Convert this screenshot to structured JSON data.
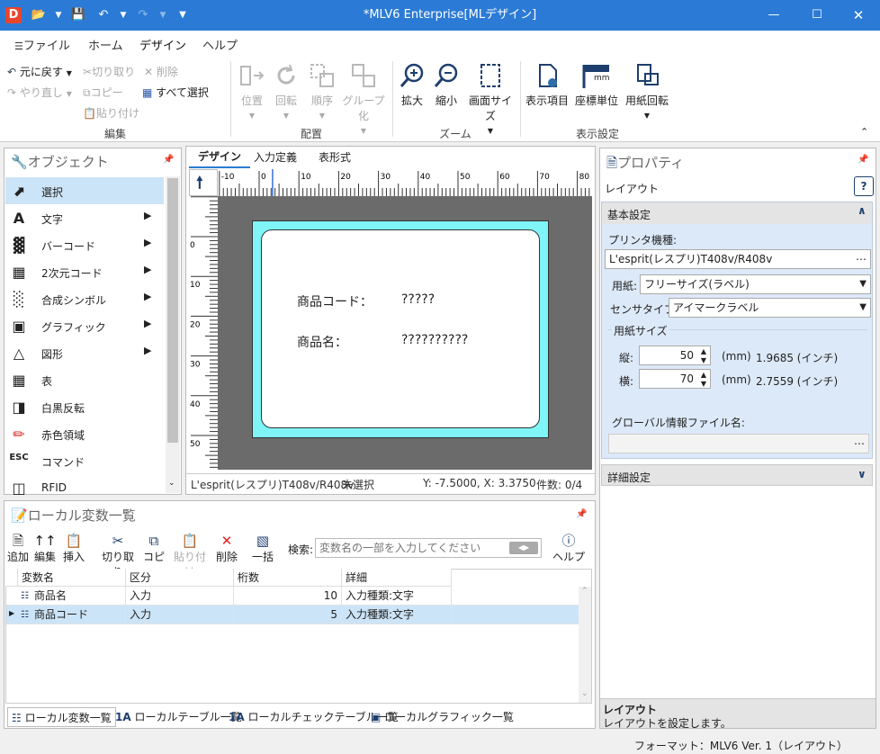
{
  "window": {
    "title": "*MLV6 Enterprise[MLデザイン]"
  },
  "ribbon": {
    "tabs": [
      "ファイル",
      "ホーム",
      "デザイン",
      "ヘルプ"
    ],
    "edit": {
      "undo": "元に戻す",
      "redo": "やり直し",
      "cut": "切り取り",
      "copy": "コピー",
      "paste": "貼り付け",
      "delete": "削除",
      "select_all": "すべて選択",
      "group": "編集"
    },
    "arrange": {
      "position": "位置",
      "rotate": "回転",
      "order": "順序",
      "group_btn": "グループ化",
      "group": "配置"
    },
    "zoom": {
      "zoom_in": "拡大",
      "zoom_out": "縮小",
      "screen_size": "画面サイズ",
      "group": "ズーム"
    },
    "display": {
      "display_items": "表示項目",
      "coord_unit": "座標単位",
      "paper_rotate": "用紙回転",
      "group": "表示設定",
      "mm": "mm"
    }
  },
  "objects": {
    "title": "オブジェクト",
    "items": [
      {
        "label": "選択",
        "icon": "cursor-icon"
      },
      {
        "label": "文字",
        "icon": "text-icon"
      },
      {
        "label": "バーコード",
        "icon": "barcode-icon"
      },
      {
        "label": "2次元コード",
        "icon": "qrcode-icon"
      },
      {
        "label": "合成シンボル",
        "icon": "composite-symbol-icon"
      },
      {
        "label": "グラフィック",
        "icon": "graphic-icon"
      },
      {
        "label": "図形",
        "icon": "shape-icon"
      },
      {
        "label": "表",
        "icon": "table-icon"
      },
      {
        "label": "白黒反転",
        "icon": "invert-icon"
      },
      {
        "label": "赤色領域",
        "icon": "red-area-icon"
      },
      {
        "label": "コマンド",
        "icon": "esc-command-icon"
      },
      {
        "label": "RFID",
        "icon": "rfid-icon"
      }
    ]
  },
  "design": {
    "tabs": [
      "デザイン",
      "入力定義",
      "表形式"
    ],
    "ruler_h": [
      "-10",
      "0",
      "10",
      "20",
      "30",
      "40",
      "50",
      "60",
      "70",
      "80"
    ],
    "ruler_v": [
      "0",
      "10",
      "20",
      "30",
      "40",
      "50"
    ],
    "label": {
      "row1_key": "商品コード：",
      "row1_val": "?????",
      "row2_key": "商品名：",
      "row2_val": "??????????"
    },
    "status": {
      "printer": "L'esprit(レスプリ)T408v/R408v",
      "selection": "未選択",
      "coords": "Y: -7.5000, X: 3.3750",
      "count": "件数: 0/4"
    }
  },
  "properties": {
    "title": "プロパティ",
    "subtitle": "レイアウト",
    "basic": "基本設定",
    "printer_label": "プリンタ機種:",
    "printer_value": "L'esprit(レスプリ)T408v/R408v",
    "paper_label": "用紙:",
    "paper_value": "フリーサイズ(ラベル)",
    "sensor_label": "センサタイプ:",
    "sensor_value": "アイマークラベル",
    "size_label": "用紙サイズ",
    "height_label": "縦:",
    "height_value": "50",
    "height_unit": "(mm)",
    "height_inch": "1.9685 (インチ)",
    "width_label": "横:",
    "width_value": "70",
    "width_unit": "(mm)",
    "width_inch": "2.7559 (インチ)",
    "global_label": "グローバル情報ファイル名:",
    "detail": "詳細設定",
    "footer_title": "レイアウト",
    "footer_desc": "レイアウトを設定します。"
  },
  "locals": {
    "title": "ローカル変数一覧",
    "toolbar": {
      "add": "追加",
      "edit": "編集",
      "insert": "挿入",
      "cut": "切り取り",
      "copy": "コピー",
      "paste": "貼り付け",
      "delete": "削除",
      "bulk": "一括",
      "search_label": "検索:",
      "search_placeholder": "変数名の一部を入力してください",
      "help": "ヘルプ"
    },
    "columns": [
      "変数名",
      "区分",
      "桁数",
      "詳細"
    ],
    "rows": [
      {
        "name": "商品名",
        "kind": "入力",
        "digits": "10",
        "detail": "入力種類:文字"
      },
      {
        "name": "商品コード",
        "kind": "入力",
        "digits": "5",
        "detail": "入力種類:文字"
      }
    ],
    "bottom_tabs": [
      "ローカル変数一覧",
      "ローカルテーブル一覧",
      "ローカルチェックテーブル一覧",
      "ローカルグラフィック一覧"
    ]
  },
  "statusbar": {
    "format": "フォーマット：MLV6 Ver. 1（レイアウト）"
  },
  "colors": {
    "title_bar": "#2b7bd6",
    "label_border": "#7ff5f7",
    "canvas": "#6b6b6b",
    "select_row": "#cce4f7"
  }
}
